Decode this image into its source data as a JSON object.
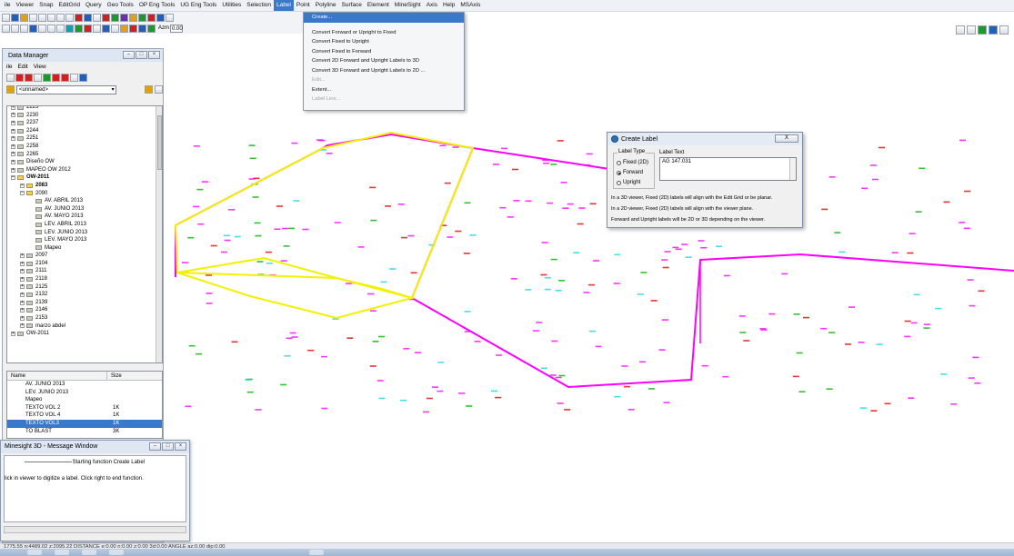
{
  "menubar": {
    "items": [
      "ile",
      "Viewer",
      "Snap",
      "EditGrid",
      "Query",
      "Geo Tools",
      "OP Eng Tools",
      "UG Eng Tools",
      "Utilities",
      "Selection",
      "Label",
      "Point",
      "Polyline",
      "Surface",
      "Element",
      "MineSight",
      "Axis",
      "Help",
      "MSAxis"
    ],
    "active": "Label"
  },
  "toolbar": {
    "azm_label": "Azm",
    "azm_value": "0.00"
  },
  "label_menu": {
    "create": "Create...",
    "convert_forward_upright_fixed": "Convert Forward or Upright to Fixed",
    "convert_fixed_upright": "Convert Fixed to Upright",
    "convert_fixed_forward": "Convert Fixed to Forward",
    "convert_2d_to_3d": "Convert 2D Forward and Upright Labels to 3D",
    "convert_3d_to_2d": "Convert 3D Forward and Upright Labels to 2D ...",
    "edit": "Edit...",
    "extent": "Extent...",
    "label_line": "Label Line..."
  },
  "data_manager": {
    "title": "Data Manager",
    "menu": [
      "ile",
      "Edit",
      "View"
    ],
    "combo_value": "<unnamed>",
    "tree": [
      {
        "label": "2223",
        "depth": 1,
        "open": false
      },
      {
        "label": "2230",
        "depth": 1,
        "open": false
      },
      {
        "label": "2237",
        "depth": 1,
        "open": false
      },
      {
        "label": "2244",
        "depth": 1,
        "open": false
      },
      {
        "label": "2251",
        "depth": 1,
        "open": false
      },
      {
        "label": "2258",
        "depth": 1,
        "open": false
      },
      {
        "label": "2265",
        "depth": 1,
        "open": false
      },
      {
        "label": "Diseño OW",
        "depth": 1,
        "open": false
      },
      {
        "label": "MAPEO OW 2012",
        "depth": 1,
        "open": false
      },
      {
        "label": "OW-2011",
        "depth": 1,
        "open": true,
        "bold": true
      },
      {
        "label": "2083",
        "depth": 2,
        "open": true,
        "bold": true
      },
      {
        "label": "2090",
        "depth": 2,
        "open": true
      },
      {
        "label": "AV. ABRIL 2013",
        "depth": 3,
        "open": false
      },
      {
        "label": "AV. JUNIO 2013",
        "depth": 3,
        "open": false
      },
      {
        "label": "AV. MAYO 2013",
        "depth": 3,
        "open": false
      },
      {
        "label": "LEV. ABRIL 2013",
        "depth": 3,
        "open": false
      },
      {
        "label": "LEV. JUNIO 2013",
        "depth": 3,
        "open": false
      },
      {
        "label": "LEV. MAYO 2013",
        "depth": 3,
        "open": false
      },
      {
        "label": "Mapeo",
        "depth": 3,
        "open": false
      },
      {
        "label": "2097",
        "depth": 2,
        "open": false
      },
      {
        "label": "2104",
        "depth": 2,
        "open": false
      },
      {
        "label": "2111",
        "depth": 2,
        "open": false
      },
      {
        "label": "2118",
        "depth": 2,
        "open": false
      },
      {
        "label": "2125",
        "depth": 2,
        "open": false
      },
      {
        "label": "2132",
        "depth": 2,
        "open": false
      },
      {
        "label": "2139",
        "depth": 2,
        "open": false
      },
      {
        "label": "2146",
        "depth": 2,
        "open": false
      },
      {
        "label": "2153",
        "depth": 2,
        "open": false
      },
      {
        "label": "marzo abdel",
        "depth": 2,
        "open": false
      },
      {
        "label": "OW-2011",
        "depth": 1,
        "open": false
      }
    ],
    "list_headers": [
      "Name",
      "Size"
    ],
    "list_rows": [
      {
        "name": "AV. JUNIO 2013",
        "size": ""
      },
      {
        "name": "LEV. JUNIO 2013",
        "size": ""
      },
      {
        "name": "Mapeo",
        "size": ""
      },
      {
        "name": "TEXTO VOL 2",
        "size": "1K"
      },
      {
        "name": "TEXTO VOL 4",
        "size": "1K"
      },
      {
        "name": "TEXTO VOL3",
        "size": "1K",
        "selected": true
      },
      {
        "name": "TO BLAST",
        "size": "3K"
      }
    ]
  },
  "message_window": {
    "title": "Minesight 3D - Message Window",
    "line1": "Starting function Create Label",
    "line2": "lick in viewer to digitize a label.  Click right to end function."
  },
  "create_label": {
    "title": "Create Label",
    "close": "X",
    "label_type": "Label Type",
    "fixed": "Fixed (2D)",
    "forward": "Forward",
    "upright": "Upright",
    "label_text": "Label Text",
    "text_value": "AG 147.031",
    "info1": "In a 3D viewer, Fixed (2D) labels will align with the Edit Grid or be planar.",
    "info2": "In a 2D viewer, Fixed (2D) labels will align with the viewer plane.",
    "info3": "Forward and Upright labels will be 2D or 3D depending on the viewer."
  },
  "status": {
    "coords": "1775.55 n:4489.02 z:2095.22  DISTANCE  e:0.00  n:0.00  z:0.00  3d:0.00  ANGLE  az:0.00  dip:0.00"
  },
  "colors": {
    "magenta": "#ff00ff",
    "yellow": "#f2f200",
    "cyan": "#19d4e6",
    "green": "#00b200",
    "red": "#e00000"
  }
}
